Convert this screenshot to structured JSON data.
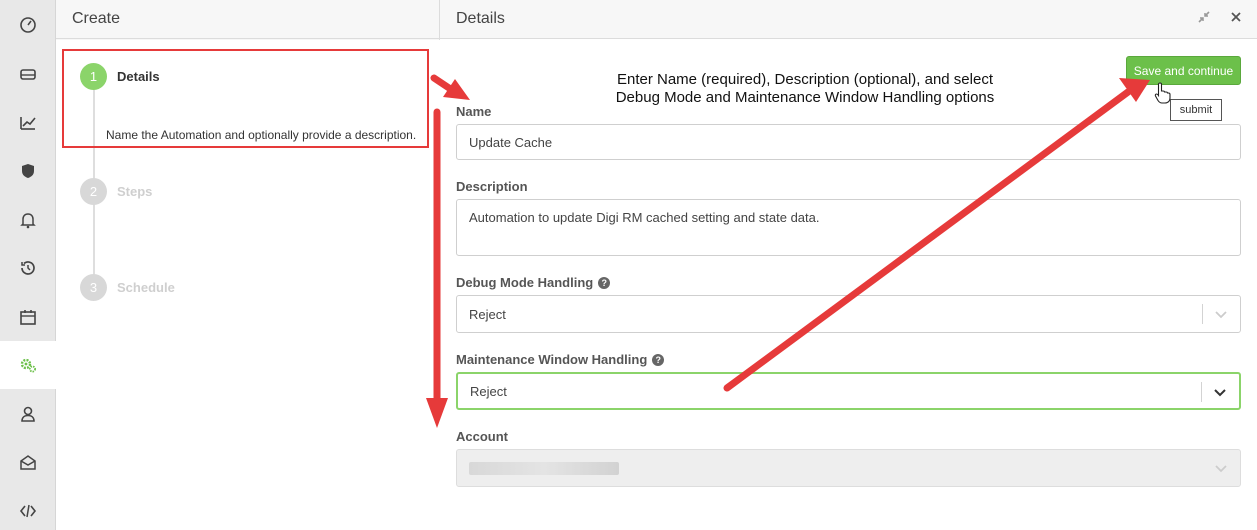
{
  "rail": {
    "items": [
      {
        "name": "dashboard-icon",
        "active": false
      },
      {
        "name": "devices-icon",
        "active": false
      },
      {
        "name": "analytics-icon",
        "active": false
      },
      {
        "name": "security-shield-icon",
        "active": false
      },
      {
        "name": "alerts-bell-icon",
        "active": false
      },
      {
        "name": "history-icon",
        "active": false
      },
      {
        "name": "calendar-icon",
        "active": false
      },
      {
        "name": "automations-gears-icon",
        "active": true
      },
      {
        "name": "user-icon",
        "active": false
      },
      {
        "name": "inbox-icon",
        "active": false
      },
      {
        "name": "code-icon",
        "active": false
      }
    ],
    "active_color": "#6cc04a"
  },
  "create_panel": {
    "title": "Create",
    "steps": [
      {
        "number": "1",
        "title": "Details",
        "state": "active"
      },
      {
        "number": "2",
        "title": "Steps",
        "state": "pending"
      },
      {
        "number": "3",
        "title": "Schedule",
        "state": "pending"
      }
    ],
    "step1_description": "Name the Automation and optionally provide a description."
  },
  "details_panel": {
    "title": "Details",
    "save_button": "Save and continue",
    "tooltip": "submit",
    "annotation_line1": "Enter Name (required), Description (optional), and select",
    "annotation_line2": "Debug Mode and Maintenance Window Handling options",
    "fields": {
      "name_label": "Name",
      "name_value": "Update Cache",
      "description_label": "Description",
      "description_value": "Automation to update Digi RM cached setting and state data.",
      "debug_label": "Debug Mode Handling",
      "debug_value": "Reject",
      "maintenance_label": "Maintenance Window Handling",
      "maintenance_value": "Reject",
      "account_label": "Account"
    },
    "help_glyph": "?"
  },
  "colors": {
    "accent_green": "#6cc04a",
    "step_done": "#8bd46a",
    "annotation_red": "#e63a3a"
  }
}
